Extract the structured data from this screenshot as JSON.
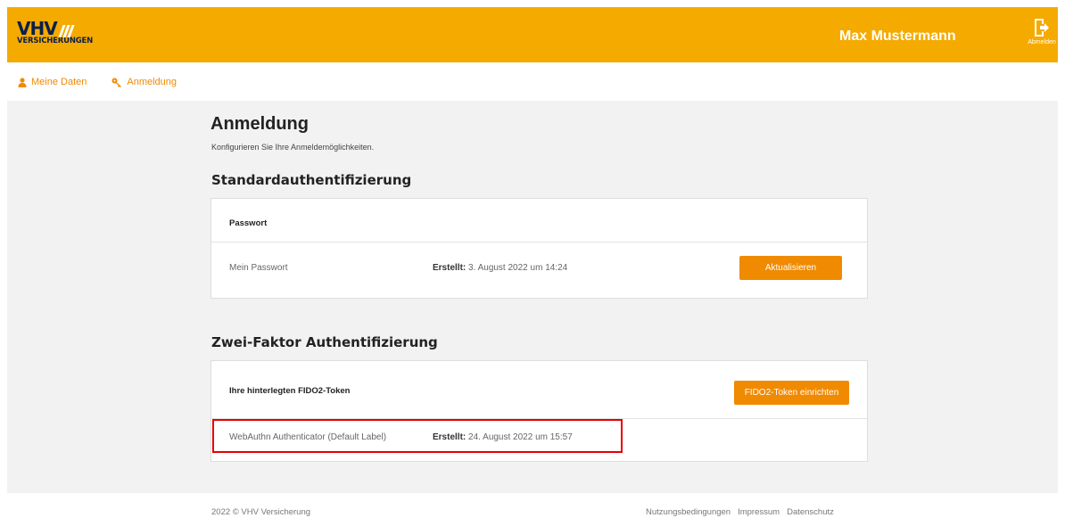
{
  "header": {
    "logo_main": "VHV",
    "logo_sub": "VERSICHERUNGEN",
    "user_name": "Max Mustermann",
    "logout_label": "Abmelden"
  },
  "subnav": {
    "items": [
      {
        "label": "Meine Daten",
        "icon": "user-icon"
      },
      {
        "label": "Anmeldung",
        "icon": "key-icon"
      }
    ]
  },
  "main": {
    "title": "Anmeldung",
    "subtitle": "Konfigurieren Sie Ihre Anmeldemöglichkeiten.",
    "standard_auth": {
      "title": "Standardauthentifizierung",
      "card_title": "Passwort",
      "row": {
        "label": "Mein Passwort",
        "created_label": "Erstellt:",
        "created_value": "3. August 2022 um 14:24",
        "button": "Aktualisieren"
      }
    },
    "two_factor": {
      "title": "Zwei-Faktor Authentifizierung",
      "card_title": "Ihre hinterlegten FIDO2-Token",
      "button": "FIDO2-Token einrichten",
      "row": {
        "label": "WebAuthn Authenticator (Default Label)",
        "created_label": "Erstellt:",
        "created_value": "24. August 2022 um 15:57"
      }
    }
  },
  "footer": {
    "copyright": "2022 © VHV Versicherung",
    "links": [
      "Nutzungsbedingungen",
      "Impressum",
      "Datenschutz"
    ]
  },
  "colors": {
    "header_bg": "#f5aa00",
    "accent": "#f08a00",
    "logo_navy": "#0b1f4a",
    "highlight": "#e60000"
  }
}
